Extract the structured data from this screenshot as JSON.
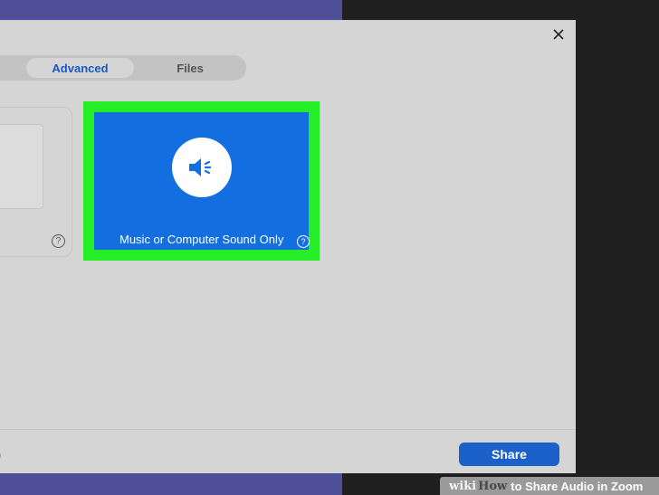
{
  "dialog": {
    "tabs": [
      {
        "label": "Advanced",
        "selected": true
      },
      {
        "label": "Files",
        "selected": false
      }
    ],
    "left_card_label": "n",
    "sound_option_label": "Music or Computer Sound Only",
    "help_glyph": "?",
    "footer_left_text": "p",
    "share_label": "Share"
  },
  "watermark": {
    "brand_part1": "wiki",
    "brand_part2": "How",
    "title": "to Share Audio in Zoom"
  },
  "colors": {
    "highlight": "#26ee26",
    "sound_card": "#136fe0",
    "share_button": "#1c61c9",
    "tab_selected_text": "#1b59c4"
  },
  "icons": {
    "close": "close-icon",
    "speaker": "speaker-icon",
    "help": "help-icon"
  }
}
